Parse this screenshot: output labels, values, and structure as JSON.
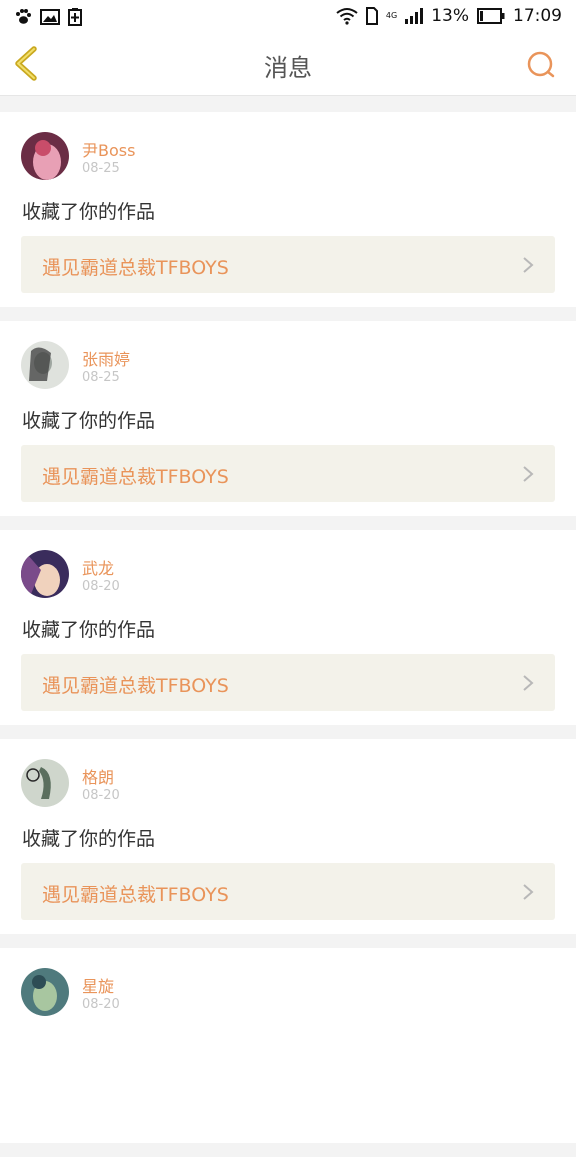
{
  "status_bar": {
    "battery_percent": "13%",
    "time": "17:09",
    "network_label": "4G",
    "icons": [
      "paw-icon",
      "image-icon",
      "battery-saver-icon",
      "wifi-icon",
      "sim-icon",
      "signal-icon",
      "battery-icon"
    ]
  },
  "header": {
    "title": "消息",
    "back_icon": "chevron-left-icon",
    "search_icon": "search-icon"
  },
  "colors": {
    "accent": "#e9945a",
    "back_icon": "#c9a81f",
    "work_bg": "#f3f2ea",
    "page_bg": "#f3f3f3"
  },
  "messages": [
    {
      "name": "尹Boss",
      "date": "08-25",
      "action": "收藏了你的作品",
      "work_title": "遇见霸道总裁TFBOYS",
      "avatar_colors": [
        "#6b2d45",
        "#e8a0b5",
        "#c94d6a"
      ]
    },
    {
      "name": "张雨婷",
      "date": "08-25",
      "action": "收藏了你的作品",
      "work_title": "遇见霸道总裁TFBOYS",
      "avatar_colors": [
        "#dfe2dd",
        "#9fa6a0",
        "#3c3c3c"
      ]
    },
    {
      "name": "武龙",
      "date": "08-20",
      "action": "收藏了你的作品",
      "work_title": "遇见霸道总裁TFBOYS",
      "avatar_colors": [
        "#3a2c5c",
        "#f0d2bd",
        "#7a4b8a"
      ]
    },
    {
      "name": "格朗",
      "date": "08-20",
      "action": "收藏了你的作品",
      "work_title": "遇见霸道总裁TFBOYS",
      "avatar_colors": [
        "#cfd6cc",
        "#5b6f5e",
        "#2a2a2a"
      ]
    },
    {
      "name": "星旋",
      "date": "08-20",
      "action": "",
      "work_title": "",
      "avatar_colors": [
        "#4f7a7d",
        "#a8c6a0",
        "#2d4d55"
      ]
    }
  ]
}
